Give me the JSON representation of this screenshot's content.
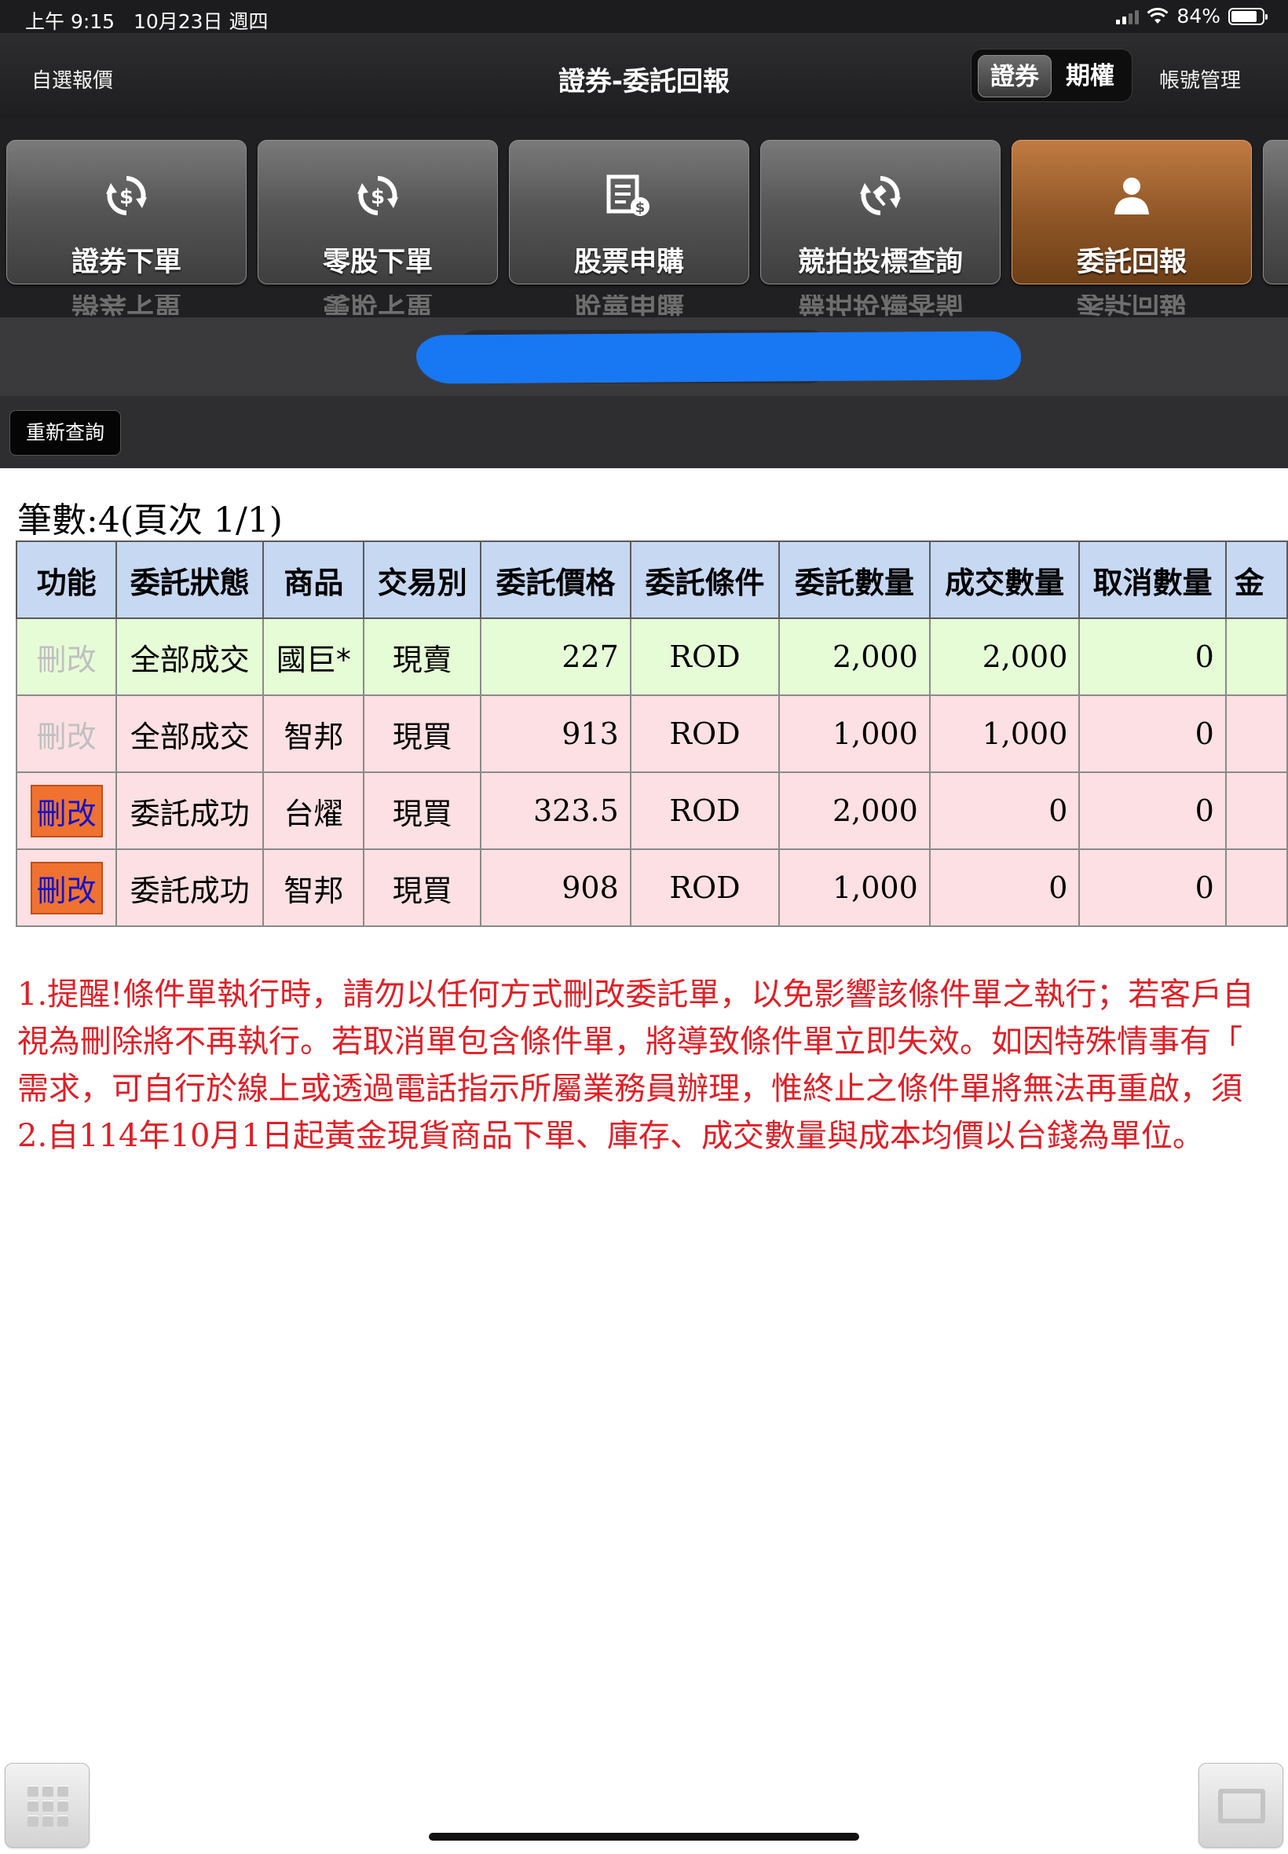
{
  "status_bar": {
    "time": "上午 9:15",
    "date": "10月23日 週四",
    "battery": "84%",
    "battery_level": 0.84
  },
  "nav": {
    "left_label": "自選報價",
    "title": "證券-委託回報",
    "segment": [
      "證券",
      "期權"
    ],
    "right_label": "帳號管理"
  },
  "tiles": [
    {
      "label": "證券下單",
      "icon": "dollar-refresh-icon"
    },
    {
      "label": "零股下單",
      "icon": "dollar-refresh-icon"
    },
    {
      "label": "股票申購",
      "icon": "document-dollar-icon"
    },
    {
      "label": "競拍投標查詢",
      "icon": "gavel-refresh-icon"
    },
    {
      "label": "委託回報",
      "icon": "person-icon",
      "active": true
    }
  ],
  "requery_label": "重新查詢",
  "record_count": "筆數:4(頁次 1/1)",
  "table": {
    "headers": [
      "功能",
      "委託狀態",
      "商品",
      "交易別",
      "委託價格",
      "委託條件",
      "委託數量",
      "成交數量",
      "取消數量",
      "金"
    ],
    "rows": [
      {
        "fn": "刪改",
        "fn_enabled": false,
        "status": "全部成交",
        "product": "國巨*",
        "side": "現賣",
        "price": "227",
        "cond": "ROD",
        "qty": "2,000",
        "filled": "2,000",
        "cancel": "0",
        "tone": "green"
      },
      {
        "fn": "刪改",
        "fn_enabled": false,
        "status": "全部成交",
        "product": "智邦",
        "side": "現買",
        "price": "913",
        "cond": "ROD",
        "qty": "1,000",
        "filled": "1,000",
        "cancel": "0",
        "tone": "pink"
      },
      {
        "fn": "刪改",
        "fn_enabled": true,
        "status": "委託成功",
        "product": "台燿",
        "side": "現買",
        "price": "323.5",
        "cond": "ROD",
        "qty": "2,000",
        "filled": "0",
        "cancel": "0",
        "tone": "pink"
      },
      {
        "fn": "刪改",
        "fn_enabled": true,
        "status": "委託成功",
        "product": "智邦",
        "side": "現買",
        "price": "908",
        "cond": "ROD",
        "qty": "1,000",
        "filled": "0",
        "cancel": "0",
        "tone": "pink"
      }
    ]
  },
  "notes": [
    "1.提醒!條件單執行時，請勿以任何方式刪改委託單，以免影響該條件單之執行；若客戶自",
    "視為刪除將不再執行。若取消單包含條件單，將導致條件單立即失效。如因特殊情事有「",
    "需求，可自行於線上或透過電話指示所屬業務員辦理，惟終止之條件單將無法再重啟，須",
    "2.自114年10月1日起黃金現貨商品下單、庫存、成交數量與成本均價以台錢為單位。"
  ],
  "colors": {
    "accent_tile": "#a5642f",
    "note_red": "#e01f26",
    "header_blue": "#c7d8f2",
    "row_green": "#e6fcd6",
    "row_pink": "#fde0e3",
    "fn_orange": "#f07230",
    "redaction": "#1877f2"
  }
}
